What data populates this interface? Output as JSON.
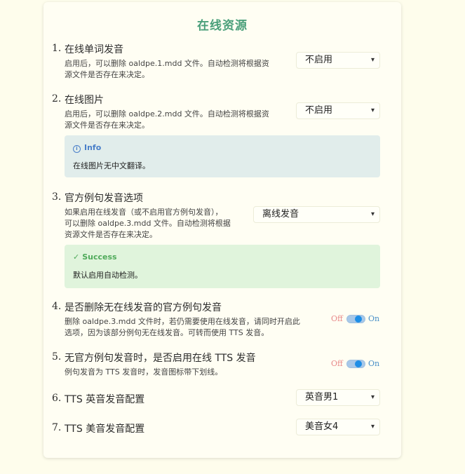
{
  "title": "在线资源",
  "items": [
    {
      "num": "1.",
      "label": "在线单词发音",
      "desc_line1": "启用后，可以删除 oaldpe.1.mdd 文件。自动检测将根据资",
      "desc_line2": "源文件是否存在来决定。",
      "select_value": "不启用"
    },
    {
      "num": "2.",
      "label": "在线图片",
      "desc_line1": "启用后，可以删除 oaldpe.2.mdd 文件。自动检测将根据资",
      "desc_line2": "源文件是否存在来决定。",
      "select_value": "不启用",
      "alert_title": "Info",
      "alert_body": "在线图片无中文翻译。"
    },
    {
      "num": "3.",
      "label": "官方例句发音选项",
      "desc_line1": "如果启用在线发音（或不启用官方例句发音），",
      "desc_line2": "可以删除 oaldpe.3.mdd 文件。自动检测将根据",
      "desc_line3": "资源文件是否存在来决定。",
      "select_value": "离线发音",
      "alert_title": "Success",
      "alert_body": "默认启用自动检测。"
    },
    {
      "num": "4.",
      "label": "是否删除无在线发音的官方例句发音",
      "desc_line1": "删除 oaldpe.3.mdd 文件时，若仍需要使用在线发音，请同时开启此",
      "desc_line2": "选项，因为该部分例句无在线发音。可转而使用 TTS 发音。",
      "toggle_off": "Off",
      "toggle_on": "On"
    },
    {
      "num": "5.",
      "label": "无官方例句发音时，是否启用在线 TTS 发音",
      "desc_line1": "例句发音为 TTS 发音时，发音图标带下划线。",
      "toggle_off": "Off",
      "toggle_on": "On"
    },
    {
      "num": "6.",
      "label": "TTS 英音发音配置",
      "select_value": "英音男1"
    },
    {
      "num": "7.",
      "label": "TTS 美音发音配置",
      "select_value": "美音女4"
    }
  ],
  "colors": {
    "title": "#4a9f7a",
    "info_bg": "#e1edeb",
    "success_bg": "#e0f4dc",
    "toggle_on": "#1e8ee6"
  }
}
